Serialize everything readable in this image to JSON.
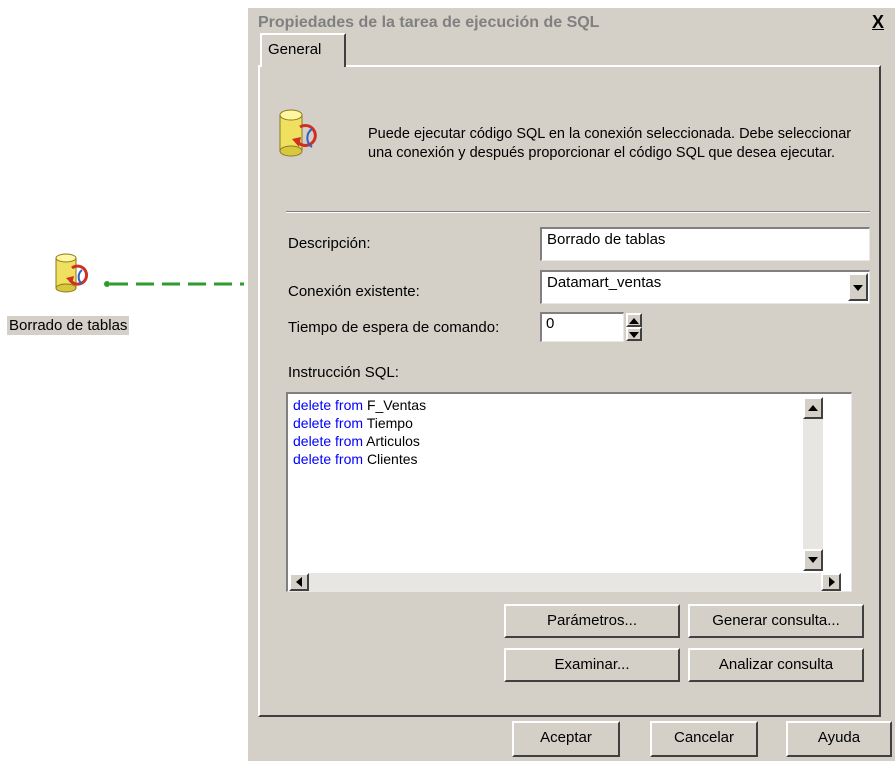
{
  "canvas": {
    "task_label": "Borrado de tablas"
  },
  "dialog": {
    "title": "Propiedades de la tarea de ejecución de SQL",
    "close": "X",
    "tab_general": "General",
    "info_text": "Puede ejecutar código SQL en la conexión seleccionada. Debe seleccionar una conexión y después proporcionar el código SQL que desea ejecutar.",
    "descripcion_label": "Descripción:",
    "descripcion_value": "Borrado de tablas",
    "conexion_label": "Conexión existente:",
    "conexion_value": "Datamart_ventas",
    "tiempo_label": "Tiempo de espera de comando:",
    "tiempo_value": "0",
    "sql_label": "Instrucción SQL:",
    "sql_keyword": "delete from",
    "sql_lines": [
      {
        "kw": "delete from",
        "table": "F_Ventas"
      },
      {
        "kw": "delete from",
        "table": "Tiempo"
      },
      {
        "kw": "delete from",
        "table": "Articulos"
      },
      {
        "kw": "delete from",
        "table": "Clientes"
      }
    ],
    "buttons": {
      "parametros": "Parámetros...",
      "generar": "Generar consulta...",
      "examinar": "Examinar...",
      "analizar": "Analizar consulta",
      "aceptar": "Aceptar",
      "cancelar": "Cancelar",
      "ayuda": "Ayuda"
    }
  },
  "colors": {
    "dialog_bg": "#d4d0c8",
    "title_text": "#808080",
    "sql_keyword": "#0000ff",
    "connector_green": "#2e9b2e"
  }
}
